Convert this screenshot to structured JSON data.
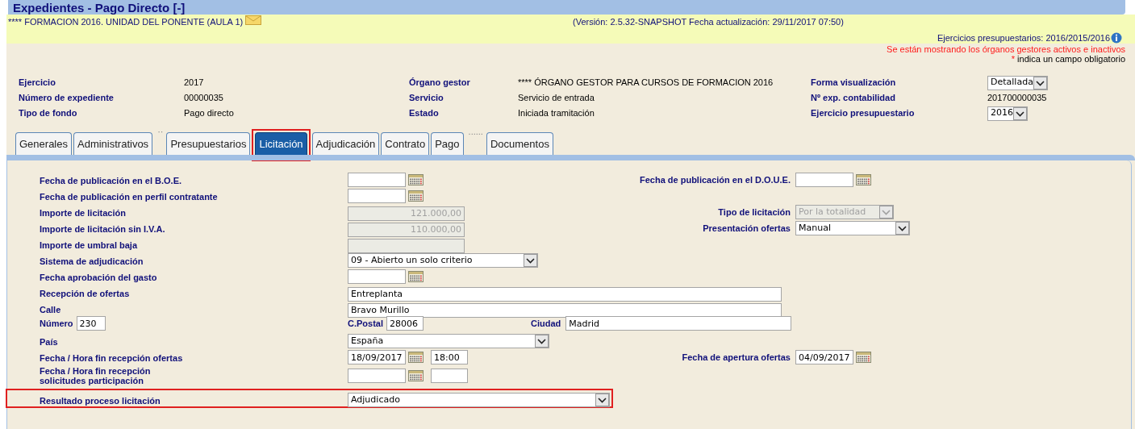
{
  "window": {
    "title": "Expedientes - Pago Directo [-]"
  },
  "banner": {
    "organization": "**** FORMACION 2016. UNIDAD DEL PONENTE (AULA 1)",
    "version": "(Versión: 2.5.32-SNAPSHOT Fecha actualización: 29/11/2017 07:50)",
    "budget_years": "Ejercicios presupuestarios: 2016/2015/2016",
    "warning": "Se están mostrando los órganos gestores activos e inactivos",
    "required_mark": "*",
    "required_note": "indica un campo obligatorio"
  },
  "info": {
    "rows": [
      [
        {
          "label": "Ejercicio",
          "kind": "text",
          "value": "2017"
        },
        {
          "label": "Órgano gestor",
          "kind": "text",
          "value": "**** ÓRGANO GESTOR PARA CURSOS DE FORMACION 2016"
        },
        {
          "label": "Forma visualización",
          "kind": "select",
          "value": "Detallada"
        }
      ],
      [
        {
          "label": "Número de expediente",
          "kind": "text",
          "value": "00000035"
        },
        {
          "label": "Servicio",
          "kind": "text",
          "value": "Servicio de entrada"
        },
        {
          "label": "Nº exp. contabilidad",
          "kind": "text",
          "value": "201700000035"
        }
      ],
      [
        {
          "label": "Tipo de fondo",
          "kind": "text",
          "value": "Pago directo"
        },
        {
          "label": "Estado",
          "kind": "text",
          "value": "Iniciada tramitación"
        },
        {
          "label": "Ejercicio presupuestario",
          "kind": "select",
          "value": "2016"
        }
      ]
    ]
  },
  "tabs": [
    {
      "label": "Generales",
      "selected": false,
      "highlighted": false
    },
    {
      "label": "Administrativos",
      "selected": false,
      "highlighted": false
    },
    {
      "label": "Presupuestarios",
      "selected": false,
      "highlighted": false,
      "separator_before": "··"
    },
    {
      "label": "Licitación",
      "selected": true,
      "highlighted": true
    },
    {
      "label": "Adjudicación",
      "selected": false,
      "highlighted": false
    },
    {
      "label": "Contrato",
      "selected": false,
      "highlighted": false
    },
    {
      "label": "Pago",
      "selected": false,
      "highlighted": false
    },
    {
      "label": "Documentos",
      "selected": false,
      "highlighted": false,
      "separator_before": "......"
    }
  ],
  "form": {
    "rows": [
      {
        "kind": "standard",
        "highlighted": false,
        "label": "Fecha de publicación en el B.O.E.",
        "field": {
          "kind": "date",
          "disabled": false
        },
        "right": {
          "label": "Fecha de publicación en el D.O.U.E.",
          "field": {
            "kind": "date",
            "disabled": false
          }
        }
      },
      {
        "kind": "standard",
        "highlighted": false,
        "label": "Fecha de publicación en perfil contratante",
        "field": {
          "kind": "date",
          "disabled": false
        }
      },
      {
        "kind": "standard",
        "highlighted": false,
        "label": "Importe de licitación",
        "field": {
          "kind": "amount",
          "value": "121.000,00",
          "disabled": true
        },
        "right": {
          "label": "Tipo de licitación",
          "field": {
            "kind": "select",
            "value": "Por la totalidad",
            "disabled": true
          }
        }
      },
      {
        "kind": "standard",
        "highlighted": false,
        "label": "Importe de licitación sin I.V.A.",
        "field": {
          "kind": "amount",
          "value": "110.000,00",
          "disabled": true
        },
        "right": {
          "label": "Presentación ofertas",
          "field": {
            "kind": "select",
            "value": "Manual",
            "disabled": false
          }
        }
      },
      {
        "kind": "standard",
        "highlighted": false,
        "label": "Importe de umbral baja",
        "field": {
          "kind": "amount",
          "disabled": true
        }
      },
      {
        "kind": "standard",
        "highlighted": false,
        "label": "Sistema de adjudicación",
        "field": {
          "kind": "select",
          "value": "09 - Abierto un solo criterio",
          "disabled": false
        }
      },
      {
        "kind": "standard",
        "highlighted": false,
        "label": "Fecha aprobación del gasto",
        "field": {
          "kind": "date",
          "disabled": false
        }
      },
      {
        "kind": "standard",
        "highlighted": false,
        "label": "Recepción de ofertas",
        "field": {
          "kind": "long_text",
          "value": "Entreplanta",
          "disabled": false
        }
      },
      {
        "kind": "standard",
        "highlighted": false,
        "label": "Calle",
        "field": {
          "kind": "long_text",
          "value": "Bravo Murillo",
          "disabled": false
        }
      },
      {
        "kind": "inline",
        "highlighted": false,
        "pairs": [
          {
            "label": "Número",
            "value": "230"
          },
          {
            "label": "C.Postal",
            "value": "28006"
          },
          {
            "label": "Ciudad",
            "value": "Madrid"
          }
        ]
      },
      {
        "kind": "standard",
        "highlighted": false,
        "label": "País",
        "field": {
          "kind": "select",
          "value": "España",
          "disabled": false
        }
      },
      {
        "kind": "standard",
        "highlighted": false,
        "label": "Fecha / Hora fin recepción ofertas",
        "field": {
          "kind": "date_time",
          "value": "18/09/2017",
          "time": "18:00",
          "disabled": false
        },
        "right": {
          "label": "Fecha de apertura ofertas",
          "field": {
            "kind": "date",
            "value": "04/09/2017",
            "disabled": false
          }
        }
      },
      {
        "kind": "standard",
        "highlighted": false,
        "label": "Fecha / Hora fin recepción solicitudes participación",
        "field": {
          "kind": "date_time",
          "disabled": false
        }
      },
      {
        "kind": "standard",
        "highlighted": true,
        "label": "Resultado proceso licitación",
        "field": {
          "kind": "select",
          "value": "Adjudicado",
          "disabled": false
        }
      }
    ]
  }
}
